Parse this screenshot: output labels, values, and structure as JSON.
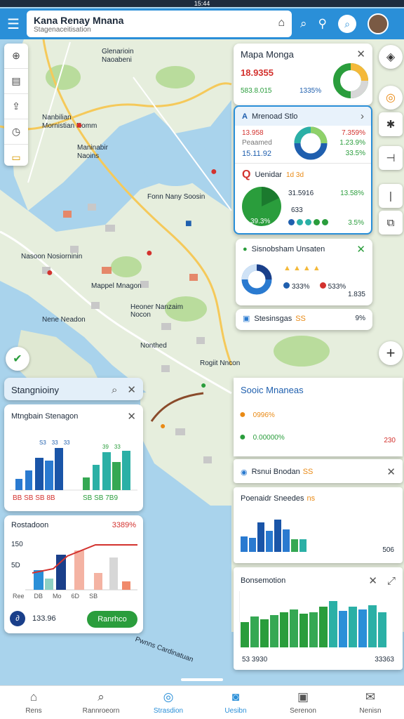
{
  "status_bar": {
    "time": "15:44"
  },
  "header": {
    "title": "Kana Renay Mnana",
    "subtitle": "Stagenaceitisation"
  },
  "map_labels": [
    {
      "text": "Glenarioin Naoabeni"
    },
    {
      "text": "Nanbilian Mornistian Nomm"
    },
    {
      "text": "Maninabir Naoins"
    },
    {
      "text": "Fonn Nany Soosin"
    },
    {
      "text": "Mappel Mnagon"
    },
    {
      "text": "Nasoon Nosiorninin"
    },
    {
      "text": "Heoner Nanzaim Nocon"
    },
    {
      "text": "Nonthed"
    },
    {
      "text": "Rogiit Nncon"
    },
    {
      "text": "Nene Neadon"
    },
    {
      "text": "Pwnns Cardinatuan"
    }
  ],
  "left_panel": {
    "title": "Stangnioiny",
    "chart1": {
      "title": "Mtngbain Stenagon",
      "labels": [
        "S3",
        "33",
        "33",
        "39",
        "33",
        "33"
      ],
      "footer_left": "BB SB SB 8B",
      "footer_right": "SB SB 7B9",
      "colors": [
        "#2a7ad0",
        "#1a55a8",
        "#2bb0a6",
        "#35a853"
      ]
    },
    "chart2": {
      "title": "Rostadoon",
      "value": "3389%",
      "y_top": "150",
      "y_mid": "5D",
      "x_labels": [
        "Ree",
        "DB",
        "Mo",
        "6D",
        "SB"
      ],
      "amount": "133.96",
      "button": "Ranrhco"
    }
  },
  "right_top": {
    "card1": {
      "title": "Mapa Monga",
      "v1": "18.9355",
      "v2": "583.8.015",
      "v3": "1335%"
    },
    "card2": {
      "title": "Mrenoad Stlo",
      "l1": "13.958",
      "l2": "Peaamed",
      "l3": "15.11.92",
      "r1": "7.359%",
      "r2": "1.23.9%",
      "r3": "33.5%"
    },
    "card3": {
      "title": "Uenidar",
      "badge": "1d 3d",
      "a": "31.5916",
      "b": "13.58%",
      "c": "633",
      "d": "3.5%",
      "pie": "39.3%"
    }
  },
  "mid_cards": {
    "card4": {
      "title": "Sisnobsham Unsaten",
      "p1": "333%",
      "p2": "533%",
      "p3": "1.835"
    },
    "card5": {
      "title": "Stesinsgas",
      "badge": "SS",
      "value": "9%"
    }
  },
  "right_bottom": {
    "card6": {
      "title": "Sooic Mnaneas",
      "v1": "0996%",
      "v2": "0.00000%",
      "v3": "230"
    },
    "card7": {
      "title": "Rsnui Bnodan",
      "badge": "SS"
    },
    "card8": {
      "title": "Poenaidr Sneedes",
      "badge": "ns",
      "foot": "506"
    },
    "card9": {
      "title": "Bonsemotion",
      "foot_left": "53 3930",
      "foot_right": "33363"
    }
  },
  "bottom_nav": [
    {
      "label": "Rens",
      "icon": "home-icon"
    },
    {
      "label": "Rannroeorn",
      "icon": "search-icon"
    },
    {
      "label": "Strasdion",
      "icon": "chat-icon"
    },
    {
      "label": "Uesibn",
      "icon": "camera-icon"
    },
    {
      "label": "Serenon",
      "icon": "image-icon"
    },
    {
      "label": "Nenisn",
      "icon": "mail-icon"
    }
  ],
  "colors": {
    "accent": "#2a8fd8",
    "green": "#2a9d3c",
    "red": "#d3322e",
    "water": "#a9d3ec",
    "land": "#e6eedd"
  }
}
